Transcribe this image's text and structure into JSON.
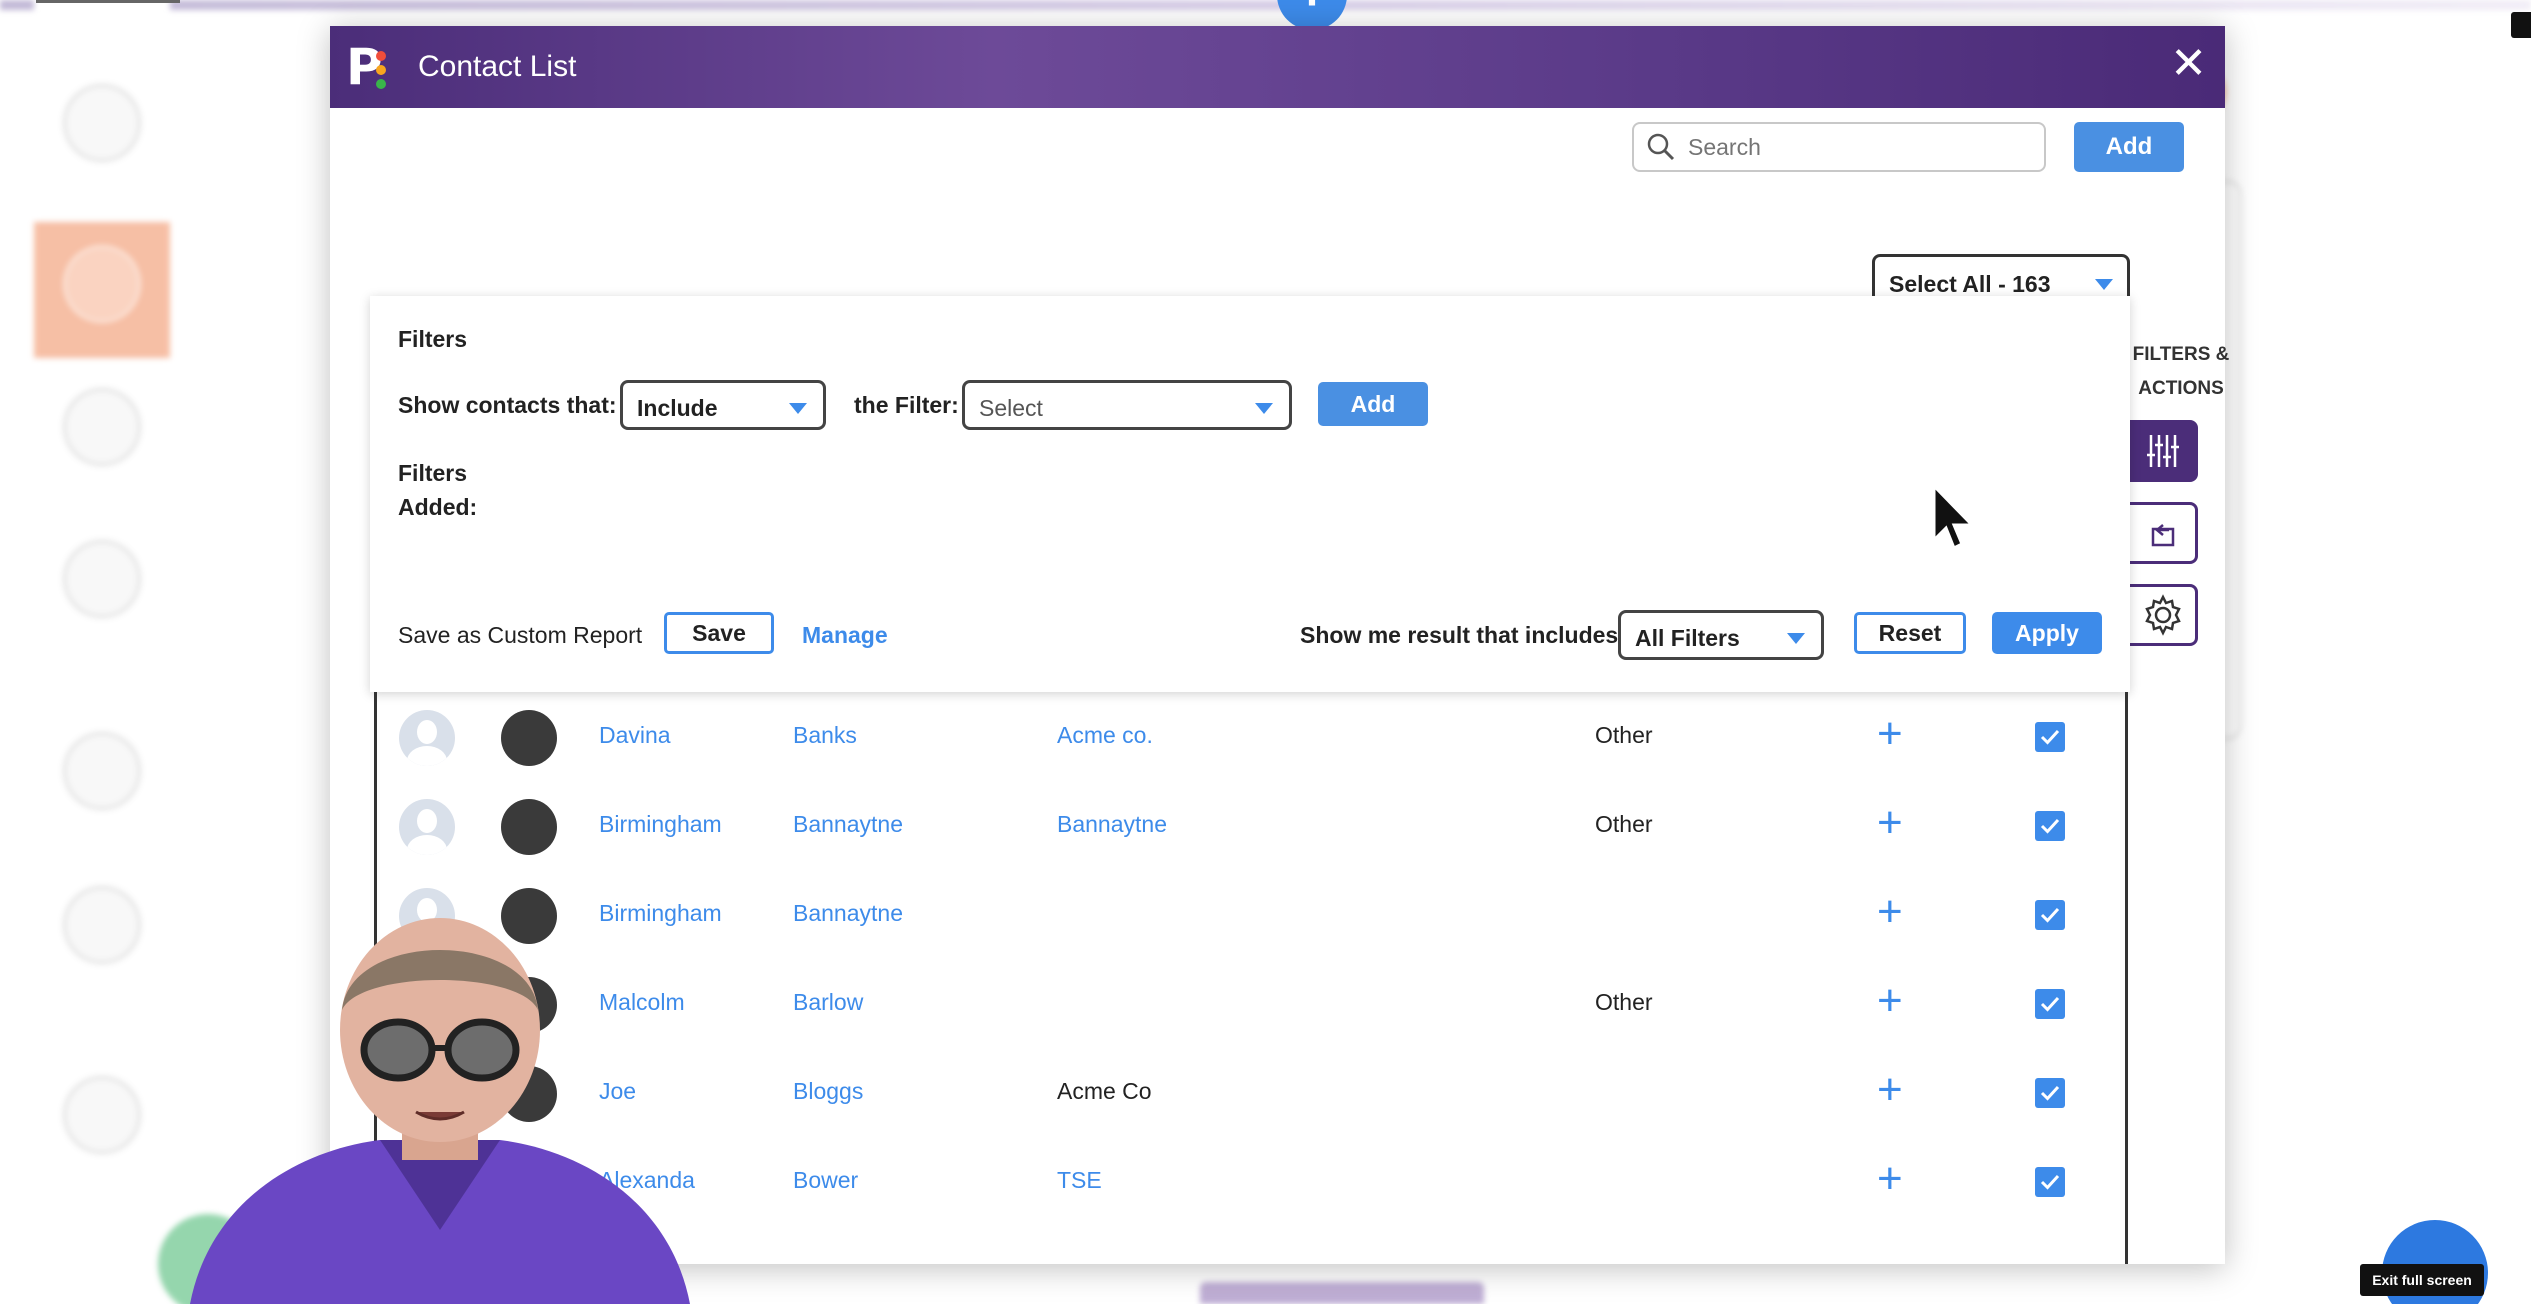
{
  "modal": {
    "title": "Contact List"
  },
  "search": {
    "placeholder": "Search"
  },
  "toolbar": {
    "add_label": "Add",
    "select_all_label": "Select All - 163"
  },
  "side_panel": {
    "label_line1": "FILTERS &",
    "label_line2": "ACTIONS"
  },
  "filters": {
    "title": "Filters",
    "show_contacts_label": "Show contacts that:",
    "include_value": "Include",
    "the_filter_label": "the Filter:",
    "filter_select_value": "Select",
    "add_label": "Add",
    "filters_added_label": "Filters Added:",
    "save_custom_label": "Save as Custom Report",
    "save_label": "Save",
    "manage_label": "Manage",
    "show_result_label": "Show me result that includes",
    "result_value": "All Filters",
    "reset_label": "Reset",
    "apply_label": "Apply"
  },
  "contacts": [
    {
      "first": "Davina",
      "last": "Banks",
      "company": "Acme co.",
      "company_link": true,
      "type": "Other",
      "checked": true
    },
    {
      "first": "Birmingham",
      "last": "Bannaytne",
      "company": "Bannaytne",
      "company_link": true,
      "type": "Other",
      "checked": true
    },
    {
      "first": "Birmingham",
      "last": "Bannaytne",
      "company": "",
      "company_link": false,
      "type": "",
      "checked": true
    },
    {
      "first": "Malcolm",
      "last": "Barlow",
      "company": "",
      "company_link": false,
      "type": "Other",
      "checked": true
    },
    {
      "first": "Joe",
      "last": "Bloggs",
      "company": "Acme Co",
      "company_link": false,
      "type": "",
      "checked": true
    },
    {
      "first": "Alexanda",
      "last": "Bower",
      "company": "TSE",
      "company_link": true,
      "type": "",
      "checked": true
    }
  ],
  "overlay": {
    "exit_fullscreen_label": "Exit full screen"
  },
  "colors": {
    "header_purple": "#4b2d79",
    "accent_blue": "#3d8bea",
    "marketing_orange": "#f08b5c"
  }
}
